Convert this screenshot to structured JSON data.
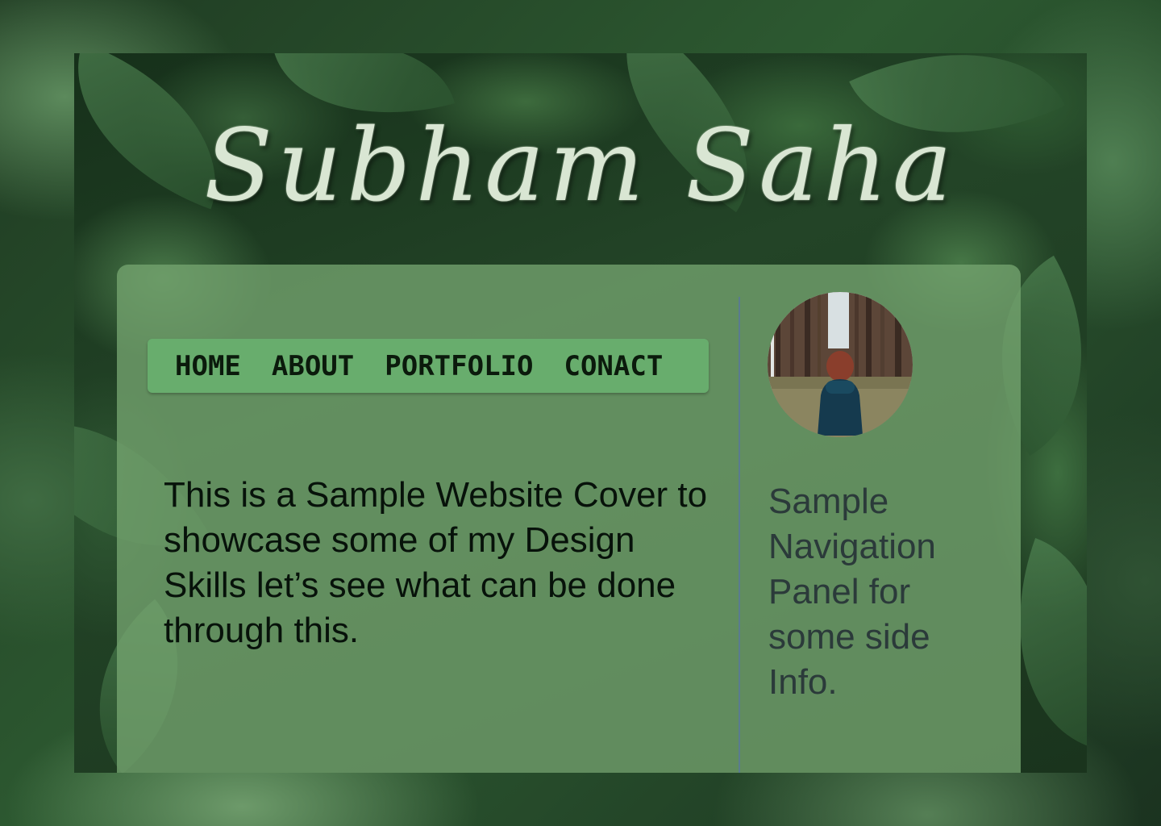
{
  "header": {
    "title": "Subham Saha"
  },
  "nav": {
    "items": [
      {
        "label": "HOME"
      },
      {
        "label": "ABOUT"
      },
      {
        "label": "PORTFOLIO"
      },
      {
        "label": "CONACT"
      }
    ]
  },
  "main": {
    "intro_text": "This is a Sample Website Cover to showcase some of my Design Skills let’s see what can be done through this."
  },
  "sidebar": {
    "avatar_icon": "profile-photo-person-in-forest",
    "text": "Sample Navigation Panel for some side Info."
  },
  "colors": {
    "nav_background": "#68ad6d",
    "panel_background": "#74a470",
    "title_color": "#d9e6d3",
    "divider": "#5a7b8f"
  }
}
